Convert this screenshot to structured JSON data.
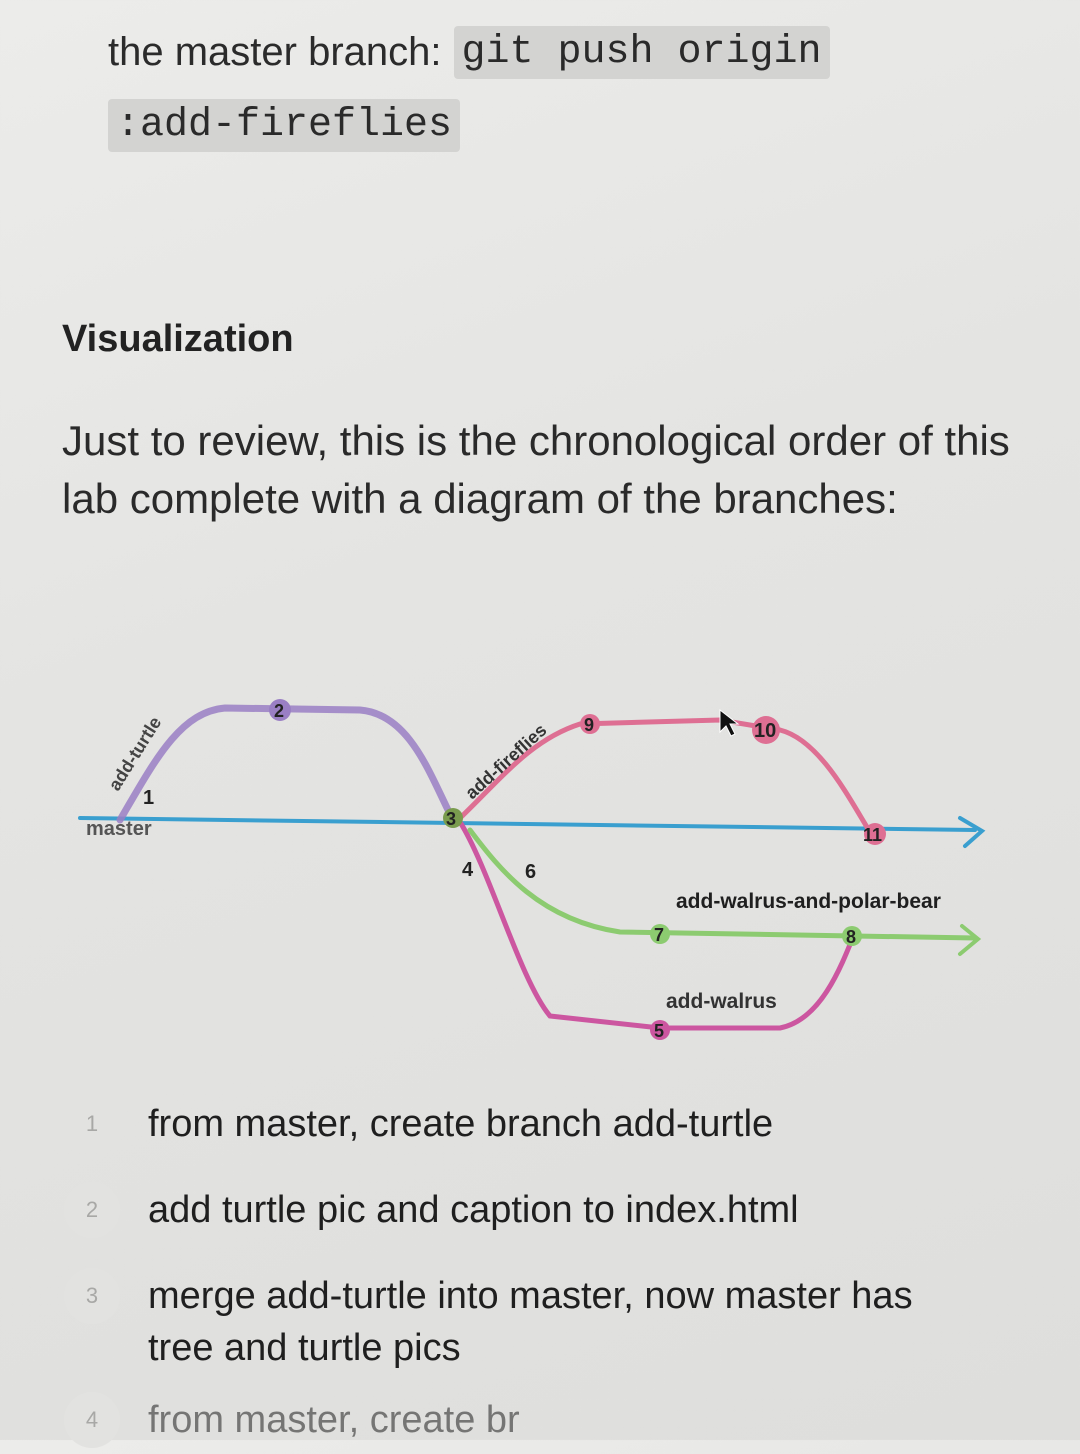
{
  "intro": {
    "prefix": "the master branch:",
    "code_line1": "git push origin",
    "code_line2": ":add-fireflies"
  },
  "section": {
    "heading": "Visualization",
    "paragraph": "Just to review, this is the chronological order of this lab complete with a diagram of the branches:"
  },
  "diagram": {
    "branch_labels": {
      "master": "master",
      "add_turtle": "add-turtle",
      "add_fireflies": "add-fireflies",
      "add_walrus_and_polar_bear": "add-walrus-and-polar-bear",
      "add_walrus": "add-walrus"
    },
    "commits": [
      "1",
      "2",
      "3",
      "4",
      "5",
      "6",
      "7",
      "8",
      "9",
      "10",
      "11"
    ],
    "colors": {
      "master": "#3a9fcf",
      "add_turtle": "#9a7fc4",
      "add_fireflies": "#de6f93",
      "add_walrus_and_polar_bear": "#8ccb70",
      "add_walrus": "#cc56a0"
    }
  },
  "steps": [
    {
      "num": "1",
      "text": "from master, create branch add-turtle"
    },
    {
      "num": "2",
      "text": "add turtle pic and caption to index.html"
    },
    {
      "num": "3",
      "text": "merge add-turtle into master, now master has tree and turtle pics"
    },
    {
      "num": "4",
      "text": "from master, create br"
    }
  ]
}
